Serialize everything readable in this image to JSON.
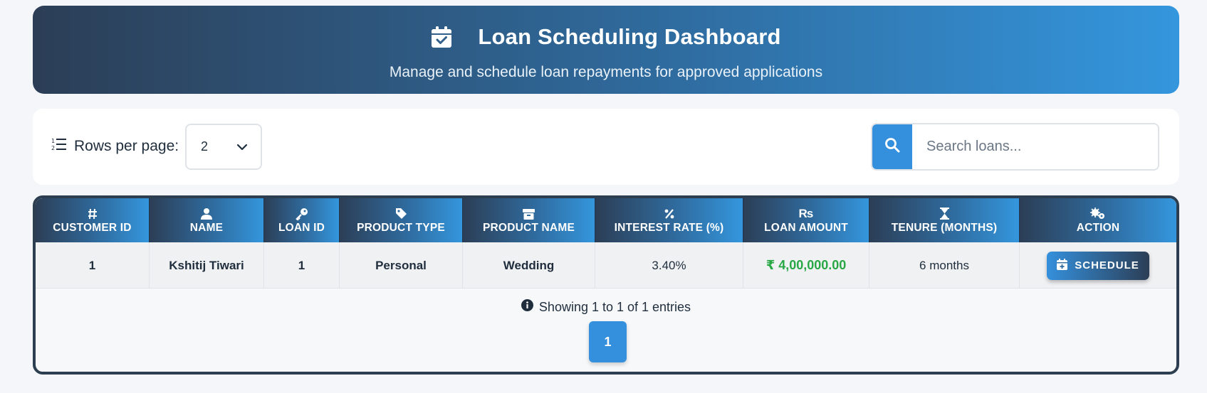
{
  "header": {
    "title": "Loan Scheduling Dashboard",
    "subtitle": "Manage and schedule loan repayments for approved applications",
    "icon": "calendar-check-icon"
  },
  "toolbar": {
    "rows_label": "Rows per page:",
    "rows_value": "2",
    "search_placeholder": "Search loans..."
  },
  "table": {
    "columns": [
      {
        "icon": "hash-icon",
        "label": "CUSTOMER ID"
      },
      {
        "icon": "user-icon",
        "label": "NAME"
      },
      {
        "icon": "key-icon",
        "label": "LOAN ID"
      },
      {
        "icon": "tag-icon",
        "label": "PRODUCT TYPE"
      },
      {
        "icon": "box-icon",
        "label": "PRODUCT NAME"
      },
      {
        "icon": "percent-icon",
        "label": "INTEREST RATE (%)"
      },
      {
        "icon": "rupee-icon",
        "label": "LOAN AMOUNT"
      },
      {
        "icon": "hourglass-icon",
        "label": "TENURE (MONTHS)"
      },
      {
        "icon": "cogs-icon",
        "label": "ACTION"
      }
    ],
    "rows": [
      {
        "customer_id": "1",
        "name": "Kshitij Tiwari",
        "loan_id": "1",
        "product_type": "Personal",
        "product_name": "Wedding",
        "interest_rate": "3.40%",
        "loan_amount": "₹ 4,00,000.00",
        "tenure": "6 months",
        "action_label": "SCHEDULE"
      }
    ]
  },
  "footer": {
    "info": "Showing 1 to 1 of 1 entries",
    "current_page": "1"
  },
  "colors": {
    "accent": "#3490dc",
    "dark": "#2c3e50",
    "amount": "#28a745"
  }
}
